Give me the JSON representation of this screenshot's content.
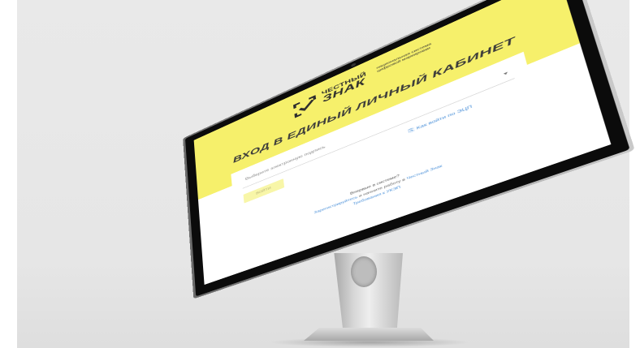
{
  "logo": {
    "line1": "ЧЕСТНЫЙ",
    "line2": "ЗНАК",
    "subtitle": "национальная система цифровой маркировки"
  },
  "page": {
    "title": "ВХОД В ЕДИНЫЙ ЛИЧНЫЙ КАБИНЕТ"
  },
  "form": {
    "cert_select_placeholder": "Выберите электронную подпись",
    "login_button": "ВОЙТИ",
    "cert_link": "Как войти по ЭЦП",
    "first_time": "Впервые в системе?",
    "register_link": "Зарегистрируйтесь",
    "register_middle": "и начните работу в",
    "system_link": "Честный Знак",
    "sign_requirements": "Требования к УКЭП"
  },
  "colors": {
    "brand_yellow": "#f6f06b",
    "link_blue": "#4a90d9"
  }
}
